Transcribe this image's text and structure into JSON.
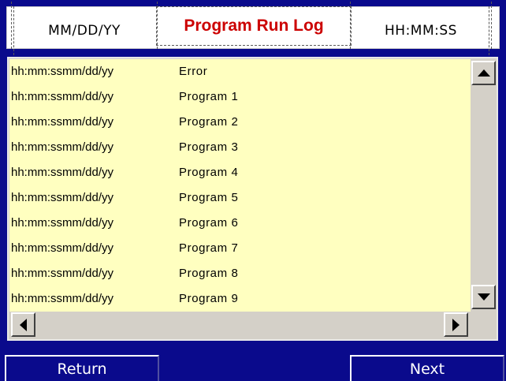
{
  "header": {
    "date_label": "MM/DD/YY",
    "title": "Program Run Log",
    "time_label": "HH:MM:SS"
  },
  "log": {
    "rows": [
      {
        "timestamp": "hh:mm:ssmm/dd/yy",
        "name": "Error"
      },
      {
        "timestamp": "hh:mm:ssmm/dd/yy",
        "name": "Program 1"
      },
      {
        "timestamp": "hh:mm:ssmm/dd/yy",
        "name": "Program 2"
      },
      {
        "timestamp": "hh:mm:ssmm/dd/yy",
        "name": "Program 3"
      },
      {
        "timestamp": "hh:mm:ssmm/dd/yy",
        "name": "Program 4"
      },
      {
        "timestamp": "hh:mm:ssmm/dd/yy",
        "name": "Program 5"
      },
      {
        "timestamp": "hh:mm:ssmm/dd/yy",
        "name": "Program 6"
      },
      {
        "timestamp": "hh:mm:ssmm/dd/yy",
        "name": "Program 7"
      },
      {
        "timestamp": "hh:mm:ssmm/dd/yy",
        "name": "Program 8"
      },
      {
        "timestamp": "hh:mm:ssmm/dd/yy",
        "name": "Program 9"
      }
    ]
  },
  "scroll": {
    "up_icon": "arrow-up-icon",
    "down_icon": "arrow-down-icon",
    "left_icon": "arrow-left-icon",
    "right_icon": "arrow-right-icon"
  },
  "nav": {
    "return_label": "Return",
    "next_label": "Next"
  },
  "colors": {
    "background": "#0a0a8c",
    "list_background": "#ffffc0",
    "title_color": "#cc0000",
    "scrollbar": "#d4d0c8"
  }
}
